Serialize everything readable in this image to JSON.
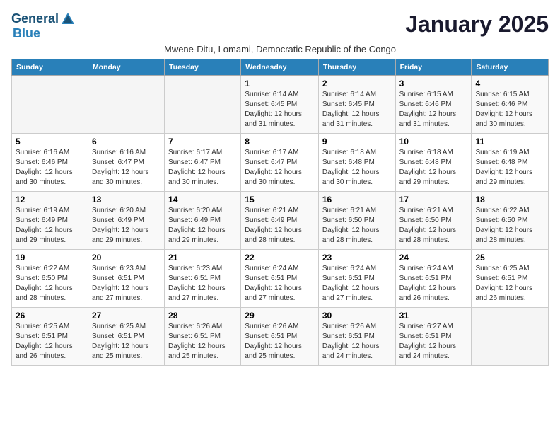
{
  "header": {
    "logo_line1": "General",
    "logo_line2": "Blue",
    "month": "January 2025",
    "subtitle": "Mwene-Ditu, Lomami, Democratic Republic of the Congo"
  },
  "weekdays": [
    "Sunday",
    "Monday",
    "Tuesday",
    "Wednesday",
    "Thursday",
    "Friday",
    "Saturday"
  ],
  "weeks": [
    [
      {
        "day": "",
        "info": ""
      },
      {
        "day": "",
        "info": ""
      },
      {
        "day": "",
        "info": ""
      },
      {
        "day": "1",
        "info": "Sunrise: 6:14 AM\nSunset: 6:45 PM\nDaylight: 12 hours\nand 31 minutes."
      },
      {
        "day": "2",
        "info": "Sunrise: 6:14 AM\nSunset: 6:45 PM\nDaylight: 12 hours\nand 31 minutes."
      },
      {
        "day": "3",
        "info": "Sunrise: 6:15 AM\nSunset: 6:46 PM\nDaylight: 12 hours\nand 31 minutes."
      },
      {
        "day": "4",
        "info": "Sunrise: 6:15 AM\nSunset: 6:46 PM\nDaylight: 12 hours\nand 30 minutes."
      }
    ],
    [
      {
        "day": "5",
        "info": "Sunrise: 6:16 AM\nSunset: 6:46 PM\nDaylight: 12 hours\nand 30 minutes."
      },
      {
        "day": "6",
        "info": "Sunrise: 6:16 AM\nSunset: 6:47 PM\nDaylight: 12 hours\nand 30 minutes."
      },
      {
        "day": "7",
        "info": "Sunrise: 6:17 AM\nSunset: 6:47 PM\nDaylight: 12 hours\nand 30 minutes."
      },
      {
        "day": "8",
        "info": "Sunrise: 6:17 AM\nSunset: 6:47 PM\nDaylight: 12 hours\nand 30 minutes."
      },
      {
        "day": "9",
        "info": "Sunrise: 6:18 AM\nSunset: 6:48 PM\nDaylight: 12 hours\nand 30 minutes."
      },
      {
        "day": "10",
        "info": "Sunrise: 6:18 AM\nSunset: 6:48 PM\nDaylight: 12 hours\nand 29 minutes."
      },
      {
        "day": "11",
        "info": "Sunrise: 6:19 AM\nSunset: 6:48 PM\nDaylight: 12 hours\nand 29 minutes."
      }
    ],
    [
      {
        "day": "12",
        "info": "Sunrise: 6:19 AM\nSunset: 6:49 PM\nDaylight: 12 hours\nand 29 minutes."
      },
      {
        "day": "13",
        "info": "Sunrise: 6:20 AM\nSunset: 6:49 PM\nDaylight: 12 hours\nand 29 minutes."
      },
      {
        "day": "14",
        "info": "Sunrise: 6:20 AM\nSunset: 6:49 PM\nDaylight: 12 hours\nand 29 minutes."
      },
      {
        "day": "15",
        "info": "Sunrise: 6:21 AM\nSunset: 6:49 PM\nDaylight: 12 hours\nand 28 minutes."
      },
      {
        "day": "16",
        "info": "Sunrise: 6:21 AM\nSunset: 6:50 PM\nDaylight: 12 hours\nand 28 minutes."
      },
      {
        "day": "17",
        "info": "Sunrise: 6:21 AM\nSunset: 6:50 PM\nDaylight: 12 hours\nand 28 minutes."
      },
      {
        "day": "18",
        "info": "Sunrise: 6:22 AM\nSunset: 6:50 PM\nDaylight: 12 hours\nand 28 minutes."
      }
    ],
    [
      {
        "day": "19",
        "info": "Sunrise: 6:22 AM\nSunset: 6:50 PM\nDaylight: 12 hours\nand 28 minutes."
      },
      {
        "day": "20",
        "info": "Sunrise: 6:23 AM\nSunset: 6:51 PM\nDaylight: 12 hours\nand 27 minutes."
      },
      {
        "day": "21",
        "info": "Sunrise: 6:23 AM\nSunset: 6:51 PM\nDaylight: 12 hours\nand 27 minutes."
      },
      {
        "day": "22",
        "info": "Sunrise: 6:24 AM\nSunset: 6:51 PM\nDaylight: 12 hours\nand 27 minutes."
      },
      {
        "day": "23",
        "info": "Sunrise: 6:24 AM\nSunset: 6:51 PM\nDaylight: 12 hours\nand 27 minutes."
      },
      {
        "day": "24",
        "info": "Sunrise: 6:24 AM\nSunset: 6:51 PM\nDaylight: 12 hours\nand 26 minutes."
      },
      {
        "day": "25",
        "info": "Sunrise: 6:25 AM\nSunset: 6:51 PM\nDaylight: 12 hours\nand 26 minutes."
      }
    ],
    [
      {
        "day": "26",
        "info": "Sunrise: 6:25 AM\nSunset: 6:51 PM\nDaylight: 12 hours\nand 26 minutes."
      },
      {
        "day": "27",
        "info": "Sunrise: 6:25 AM\nSunset: 6:51 PM\nDaylight: 12 hours\nand 25 minutes."
      },
      {
        "day": "28",
        "info": "Sunrise: 6:26 AM\nSunset: 6:51 PM\nDaylight: 12 hours\nand 25 minutes."
      },
      {
        "day": "29",
        "info": "Sunrise: 6:26 AM\nSunset: 6:51 PM\nDaylight: 12 hours\nand 25 minutes."
      },
      {
        "day": "30",
        "info": "Sunrise: 6:26 AM\nSunset: 6:51 PM\nDaylight: 12 hours\nand 24 minutes."
      },
      {
        "day": "31",
        "info": "Sunrise: 6:27 AM\nSunset: 6:51 PM\nDaylight: 12 hours\nand 24 minutes."
      },
      {
        "day": "",
        "info": ""
      }
    ]
  ]
}
